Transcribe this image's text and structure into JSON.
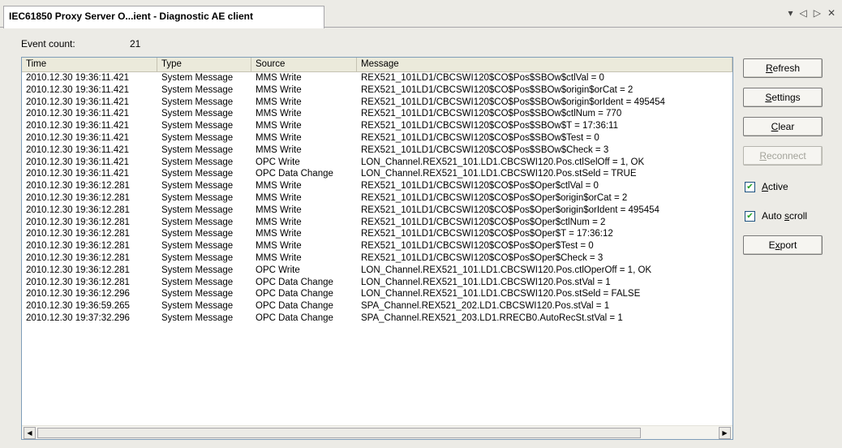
{
  "tab": {
    "title": "IEC61850 Proxy Server O...ient - Diagnostic AE client"
  },
  "tab_controls": {
    "dropdown": "▾",
    "prev": "◁",
    "next": "▷",
    "close": "✕"
  },
  "event_count": {
    "label": "Event count:",
    "value": "21"
  },
  "columns": [
    "Time",
    "Type",
    "Source",
    "Message"
  ],
  "rows": [
    [
      "2010.12.30 19:36:11.421",
      "System Message",
      "MMS Write",
      "REX521_101LD1/CBCSWI120$CO$Pos$SBOw$ctlVal = 0"
    ],
    [
      "2010.12.30 19:36:11.421",
      "System Message",
      "MMS Write",
      "REX521_101LD1/CBCSWI120$CO$Pos$SBOw$origin$orCat = 2"
    ],
    [
      "2010.12.30 19:36:11.421",
      "System Message",
      "MMS Write",
      "REX521_101LD1/CBCSWI120$CO$Pos$SBOw$origin$orIdent = 495454"
    ],
    [
      "2010.12.30 19:36:11.421",
      "System Message",
      "MMS Write",
      "REX521_101LD1/CBCSWI120$CO$Pos$SBOw$ctlNum = 770"
    ],
    [
      "2010.12.30 19:36:11.421",
      "System Message",
      "MMS Write",
      "REX521_101LD1/CBCSWI120$CO$Pos$SBOw$T = 17:36:11"
    ],
    [
      "2010.12.30 19:36:11.421",
      "System Message",
      "MMS Write",
      "REX521_101LD1/CBCSWI120$CO$Pos$SBOw$Test = 0"
    ],
    [
      "2010.12.30 19:36:11.421",
      "System Message",
      "MMS Write",
      "REX521_101LD1/CBCSWI120$CO$Pos$SBOw$Check = 3"
    ],
    [
      "2010.12.30 19:36:11.421",
      "System Message",
      "OPC Write",
      "LON_Channel.REX521_101.LD1.CBCSWI120.Pos.ctlSelOff = 1, OK"
    ],
    [
      "2010.12.30 19:36:11.421",
      "System Message",
      "OPC Data Change",
      "LON_Channel.REX521_101.LD1.CBCSWI120.Pos.stSeld = TRUE"
    ],
    [
      "2010.12.30 19:36:12.281",
      "System Message",
      "MMS Write",
      "REX521_101LD1/CBCSWI120$CO$Pos$Oper$ctlVal = 0"
    ],
    [
      "2010.12.30 19:36:12.281",
      "System Message",
      "MMS Write",
      "REX521_101LD1/CBCSWI120$CO$Pos$Oper$origin$orCat = 2"
    ],
    [
      "2010.12.30 19:36:12.281",
      "System Message",
      "MMS Write",
      "REX521_101LD1/CBCSWI120$CO$Pos$Oper$origin$orIdent = 495454"
    ],
    [
      "2010.12.30 19:36:12.281",
      "System Message",
      "MMS Write",
      "REX521_101LD1/CBCSWI120$CO$Pos$Oper$ctlNum = 2"
    ],
    [
      "2010.12.30 19:36:12.281",
      "System Message",
      "MMS Write",
      "REX521_101LD1/CBCSWI120$CO$Pos$Oper$T = 17:36:12"
    ],
    [
      "2010.12.30 19:36:12.281",
      "System Message",
      "MMS Write",
      "REX521_101LD1/CBCSWI120$CO$Pos$Oper$Test = 0"
    ],
    [
      "2010.12.30 19:36:12.281",
      "System Message",
      "MMS Write",
      "REX521_101LD1/CBCSWI120$CO$Pos$Oper$Check = 3"
    ],
    [
      "2010.12.30 19:36:12.281",
      "System Message",
      "OPC Write",
      "LON_Channel.REX521_101.LD1.CBCSWI120.Pos.ctlOperOff = 1, OK"
    ],
    [
      "2010.12.30 19:36:12.281",
      "System Message",
      "OPC Data Change",
      "LON_Channel.REX521_101.LD1.CBCSWI120.Pos.stVal = 1"
    ],
    [
      "2010.12.30 19:36:12.296",
      "System Message",
      "OPC Data Change",
      "LON_Channel.REX521_101.LD1.CBCSWI120.Pos.stSeld = FALSE"
    ],
    [
      "2010.12.30 19:36:59.265",
      "System Message",
      "OPC Data Change",
      "SPA_Channel.REX521_202.LD1.CBCSWI120.Pos.stVal = 1"
    ],
    [
      "2010.12.30 19:37:32.296",
      "System Message",
      "OPC Data Change",
      "SPA_Channel.REX521_203.LD1.RRECB0.AutoRecSt.stVal = 1"
    ]
  ],
  "scrollbar": {
    "left_arrow": "◀",
    "right_arrow": "▶"
  },
  "buttons": {
    "refresh": {
      "access": "R",
      "rest": "efresh"
    },
    "settings": {
      "access": "S",
      "rest": "ettings"
    },
    "clear": {
      "access": "C",
      "rest": "lear"
    },
    "reconnect": {
      "access": "R",
      "rest": "econnect"
    },
    "export": {
      "pre": "E",
      "access": "x",
      "rest": "port"
    }
  },
  "checkboxes": {
    "active": {
      "access": "A",
      "rest": "ctive",
      "checked": true
    },
    "auto_scroll": {
      "pre": "Auto ",
      "access": "s",
      "rest": "croll",
      "checked": true
    }
  },
  "check_mark": "✔"
}
